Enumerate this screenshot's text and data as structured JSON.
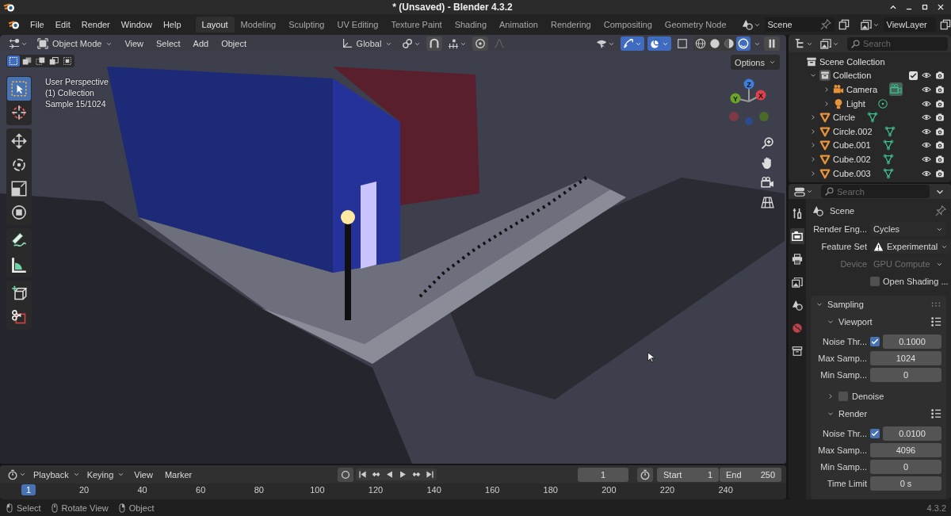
{
  "window": {
    "title": "* (Unsaved) - Blender 4.3.2"
  },
  "menu": [
    "File",
    "Edit",
    "Render",
    "Window",
    "Help"
  ],
  "workspaces": [
    {
      "label": "Layout",
      "selected": true
    },
    {
      "label": "Modeling",
      "selected": false
    },
    {
      "label": "Sculpting",
      "selected": false
    },
    {
      "label": "UV Editing",
      "selected": false
    },
    {
      "label": "Texture Paint",
      "selected": false
    },
    {
      "label": "Shading",
      "selected": false
    },
    {
      "label": "Animation",
      "selected": false
    },
    {
      "label": "Rendering",
      "selected": false
    },
    {
      "label": "Compositing",
      "selected": false
    },
    {
      "label": "Geometry Node",
      "selected": false
    }
  ],
  "scene": "Scene",
  "view_layer": "ViewLayer",
  "viewport": {
    "mode": "Object Mode",
    "menus": [
      "View",
      "Select",
      "Add",
      "Object"
    ],
    "orientation": "Global",
    "options": "Options",
    "select_modes": [
      {
        "selected": true
      },
      {
        "selected": false
      },
      {
        "selected": false
      },
      {
        "selected": false
      },
      {
        "selected": false
      }
    ],
    "toggles": [
      {
        "kind": "visibility",
        "on": false
      },
      {
        "kind": "gizmo",
        "on": true
      },
      {
        "kind": "overlay",
        "on": true
      },
      {
        "kind": "xray",
        "on": false
      }
    ],
    "shading": [
      {
        "kind": "wireframe",
        "selected": false
      },
      {
        "kind": "solid",
        "selected": false
      },
      {
        "kind": "material",
        "selected": false
      },
      {
        "kind": "rendered",
        "selected": true
      }
    ],
    "info": [
      "User Perspective",
      "(1) Collection",
      "Sample 15/1024"
    ],
    "tools": [
      {
        "kind": "select",
        "selected": true
      },
      {
        "kind": "cursor",
        "selected": false
      },
      {
        "kind": "move",
        "selected": false
      },
      {
        "kind": "rotate",
        "selected": false
      },
      {
        "kind": "scale",
        "selected": false
      },
      {
        "kind": "transform",
        "selected": false
      },
      {
        "kind": "annotate",
        "selected": false
      },
      {
        "kind": "measure",
        "selected": false
      },
      {
        "kind": "add_cube",
        "selected": false
      },
      {
        "kind": "cut",
        "selected": false
      }
    ],
    "axes": [
      "Z",
      "Y",
      "X"
    ],
    "nav": [
      {
        "kind": "zoom"
      },
      {
        "kind": "hand"
      },
      {
        "kind": "camera"
      },
      {
        "kind": "grid"
      }
    ]
  },
  "outliner": {
    "search_placeholder": "Search",
    "items": [
      {
        "name": "Scene Collection",
        "kind": "scene_collection",
        "children": [
          {
            "name": "Collection",
            "kind": "collection",
            "expanded": true,
            "checked": true,
            "children": [
              {
                "name": "Camera",
                "kind": "camera",
                "expanded": false,
                "data_active": true
              },
              {
                "name": "Light",
                "kind": "light",
                "expanded": false,
                "data_active": false
              }
            ]
          },
          {
            "name": "Circle",
            "kind": "mesh",
            "expanded": false,
            "data_active": false
          },
          {
            "name": "Circle.002",
            "kind": "mesh",
            "expanded": false,
            "data_active": false
          },
          {
            "name": "Cube.001",
            "kind": "mesh",
            "expanded": false,
            "data_active": false
          },
          {
            "name": "Cube.002",
            "kind": "mesh",
            "expanded": false,
            "data_active": false
          },
          {
            "name": "Cube.003",
            "kind": "mesh",
            "expanded": false,
            "data_active": false
          }
        ]
      }
    ]
  },
  "properties": {
    "search_placeholder": "Search",
    "tabs": [
      {
        "kind": "tool",
        "selected": false
      },
      {
        "kind": "render",
        "selected": true
      },
      {
        "kind": "output",
        "selected": false
      },
      {
        "kind": "view_layer",
        "selected": false
      },
      {
        "kind": "scene",
        "selected": false
      },
      {
        "kind": "world",
        "selected": false
      },
      {
        "kind": "collection",
        "selected": false
      }
    ],
    "context": "Scene",
    "fields": [
      {
        "kind": "dropdown",
        "label": "Render Eng...",
        "value": "Cycles",
        "warning": false,
        "disabled": false
      },
      {
        "kind": "dropdown",
        "label": "Feature Set",
        "value": "Experimental",
        "warning": true,
        "disabled": false
      },
      {
        "kind": "dropdown",
        "label": "Device",
        "value": "GPU Compute",
        "warning": false,
        "disabled": true
      },
      {
        "kind": "checkbox",
        "label": "Open Shading ...",
        "checked": false
      }
    ],
    "panels": [
      {
        "title": "Sampling",
        "expanded": true,
        "subpanels": [
          {
            "title": "Viewport",
            "expanded": true,
            "fields": [
              {
                "kind": "toggle_number",
                "label": "Noise Thr...",
                "checked": true,
                "value": "0.1000"
              },
              {
                "kind": "number",
                "label": "Max Samp...",
                "value": "1024"
              },
              {
                "kind": "number",
                "label": "Min Samp...",
                "value": "0"
              }
            ]
          },
          {
            "title": "Denoise",
            "expanded": false,
            "checked": false
          },
          {
            "title": "Render",
            "expanded": true,
            "fields": [
              {
                "kind": "toggle_number",
                "label": "Noise Thr...",
                "checked": true,
                "value": "0.0100"
              },
              {
                "kind": "number",
                "label": "Max Samp...",
                "value": "4096"
              },
              {
                "kind": "number",
                "label": "Min Samp...",
                "value": "0"
              },
              {
                "kind": "number",
                "label": "Time Limit",
                "value": "0 s"
              }
            ]
          }
        ]
      }
    ]
  },
  "timeline": {
    "menus": [
      "Playback",
      "Keying",
      "View",
      "Marker"
    ],
    "current_frame": "1",
    "start_label": "Start",
    "start": "1",
    "end_label": "End",
    "end": "250",
    "ruler": [
      {
        "label": "1",
        "current": true
      },
      {
        "label": "20",
        "current": false
      },
      {
        "label": "40",
        "current": false
      },
      {
        "label": "60",
        "current": false
      },
      {
        "label": "80",
        "current": false
      },
      {
        "label": "100",
        "current": false
      },
      {
        "label": "120",
        "current": false
      },
      {
        "label": "140",
        "current": false
      },
      {
        "label": "160",
        "current": false
      },
      {
        "label": "180",
        "current": false
      },
      {
        "label": "200",
        "current": false
      },
      {
        "label": "220",
        "current": false
      },
      {
        "label": "240",
        "current": false
      }
    ]
  },
  "status_bar": {
    "hints": [
      {
        "kind": "left_click",
        "label": "Select"
      },
      {
        "kind": "middle_click",
        "label": "Rotate View"
      },
      {
        "kind": "right_click",
        "label": "Object"
      }
    ],
    "version": "4.3.2"
  }
}
